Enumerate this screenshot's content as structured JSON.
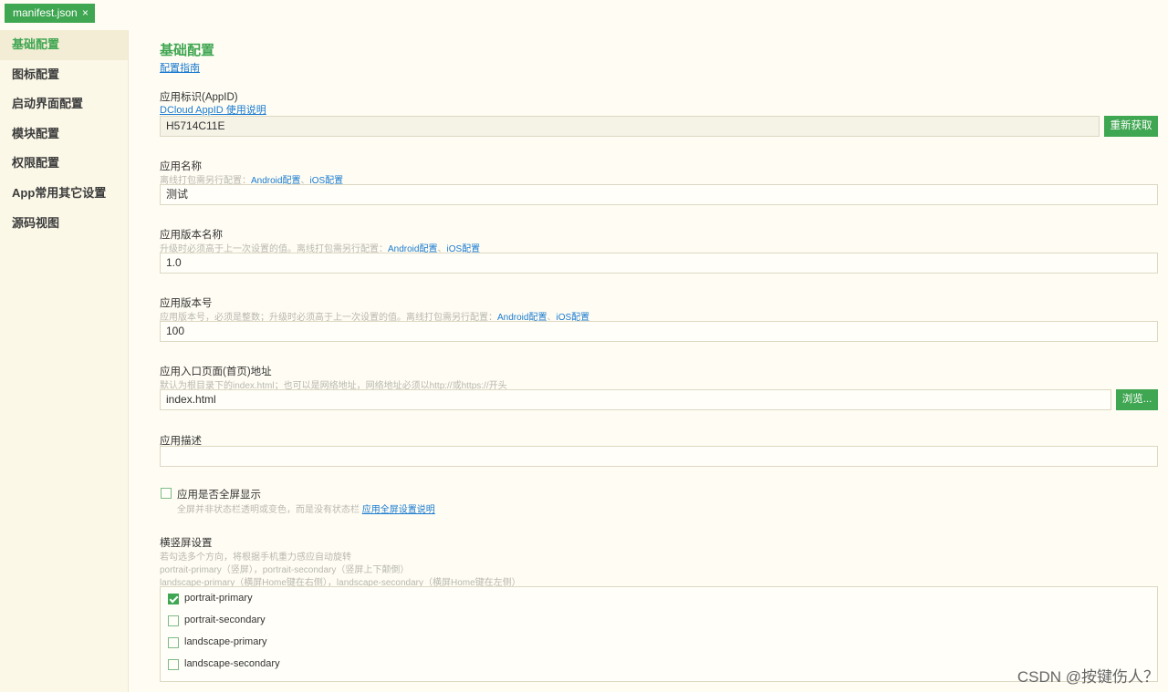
{
  "tab": {
    "label": "manifest.json",
    "close": "×"
  },
  "sidebar": {
    "items": [
      {
        "label": "基础配置"
      },
      {
        "label": "图标配置"
      },
      {
        "label": "启动界面配置"
      },
      {
        "label": "模块配置"
      },
      {
        "label": "权限配置"
      },
      {
        "label": "App常用其它设置"
      },
      {
        "label": "源码视图"
      }
    ]
  },
  "main": {
    "title": "基础配置",
    "guide_link": "配置指南",
    "appid": {
      "label": "应用标识(AppID)",
      "help_link": "DCloud AppID 使用说明",
      "value": "H5714C11E",
      "button": "重新获取"
    },
    "name": {
      "label": "应用名称",
      "hint": "离线打包需另行配置：",
      "android_link": "Android配置",
      "sep": "、",
      "ios_link": "iOS配置",
      "value": "测试"
    },
    "version_name": {
      "label": "应用版本名称",
      "hint": "升级时必须高于上一次设置的值。离线打包需另行配置：",
      "android_link": "Android配置",
      "sep": "、",
      "ios_link": "iOS配置",
      "value": "1.0"
    },
    "version_code": {
      "label": "应用版本号",
      "hint": "应用版本号，必须是整数；升级时必须高于上一次设置的值。离线打包需另行配置：",
      "android_link": "Android配置",
      "sep": "、",
      "ios_link": "iOS配置",
      "value": "100"
    },
    "entry": {
      "label": "应用入口页面(首页)地址",
      "hint": "默认为根目录下的index.html；也可以是网络地址，网络地址必须以http://或https://开头",
      "value": "index.html",
      "button": "浏览..."
    },
    "description": {
      "label": "应用描述",
      "value": ""
    },
    "fullscreen": {
      "label": "应用是否全屏显示",
      "checked": false,
      "hint": "全屏并非状态栏透明或变色，而是没有状态栏 ",
      "help_link": "应用全屏设置说明"
    },
    "orientation": {
      "label": "横竖屏设置",
      "hint1": "若勾选多个方向，将根据手机重力感应自动旋转",
      "hint2": "portrait-primary（竖屏），portrait-secondary（竖屏上下颠倒）",
      "hint3": "landscape-primary（横屏Home键在右侧），landscape-secondary（横屏Home键在左侧）",
      "options": [
        {
          "label": "portrait-primary",
          "checked": true
        },
        {
          "label": "portrait-secondary",
          "checked": false
        },
        {
          "label": "landscape-primary",
          "checked": false
        },
        {
          "label": "landscape-secondary",
          "checked": false
        }
      ]
    }
  },
  "watermark": "CSDN @按键伤人？",
  "colors": {
    "accent": "#3fa651",
    "link": "#1a7ad0",
    "background": "#fffdf3"
  }
}
